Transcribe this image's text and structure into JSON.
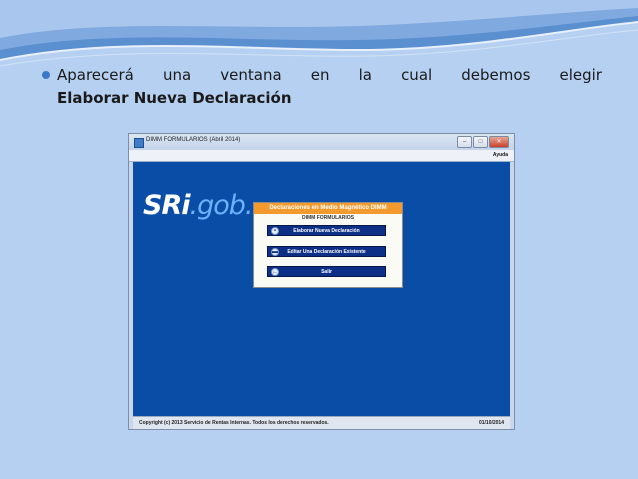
{
  "slide": {
    "bullet_words": [
      "Aparecerá",
      "una",
      "ventana",
      "en",
      "la",
      "cual",
      "debemos",
      "elegir"
    ],
    "bullet_bold": "Elaborar Nueva Declaración"
  },
  "window": {
    "title": "DIMM FORMULARIOS (Abril 2014)",
    "menu_help": "Ayuda",
    "logo_sri": "SRi",
    "logo_gob": ".gob.",
    "status_copyright": "Copyright (c) 2013 Servicio de Rentas Internas. Todos los derechos reservados.",
    "status_date": "01/10/2014"
  },
  "dialog": {
    "title": "Declaraciones en Medio Magnético DIMM",
    "subtitle": "DIMM FORMULARIOS",
    "buttons": [
      {
        "label": "Elaborar Nueva Declaración",
        "icon": "document-icon"
      },
      {
        "label": "Editar Una Declaración Existente",
        "icon": "folder-icon"
      },
      {
        "label": "Salir",
        "icon": "exit-arrow-icon"
      }
    ]
  },
  "colors": {
    "slide_background": "#b6d0f2",
    "client_blue": "#0a4da6",
    "dialog_title_orange": "#f29a2e",
    "button_navy": "#0e2f86"
  }
}
